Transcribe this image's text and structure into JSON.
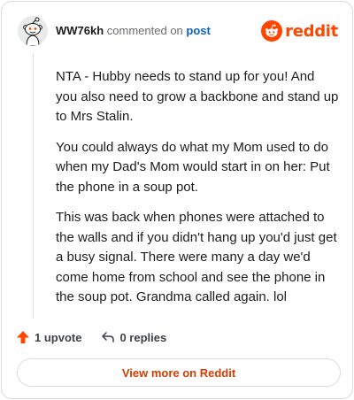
{
  "header": {
    "username": "WW76kh",
    "commented_text": "commented on",
    "post_link": "post"
  },
  "logo": {
    "word": "reddit",
    "brand_color": "#ff4500"
  },
  "comment": {
    "paragraphs": [
      "NTA - Hubby needs to stand up for you! And you also need to grow a backbone and stand up to Mrs Stalin.",
      "You could always do what my Mom used to do when my Dad's Mom would start in on her: Put the phone in a soup pot.",
      "This was back when phones were attached to the walls and if you didn't hang up you'd just get a busy signal. There were many a day we'd come home from school and see the phone in the soup pot. Grandma called again. lol"
    ]
  },
  "actions": {
    "upvote_label": "1 upvote",
    "replies_label": "0 replies"
  },
  "footer": {
    "view_more_label": "View more on Reddit"
  },
  "icons": {
    "upvote": "upvote-arrow-icon",
    "reply": "reply-arrow-icon",
    "logo": "reddit-snoo-icon",
    "avatar": "snoo-avatar-icon"
  },
  "colors": {
    "accent": "#ff4500",
    "link": "#0b62c4",
    "view_more": "#d93a00"
  }
}
